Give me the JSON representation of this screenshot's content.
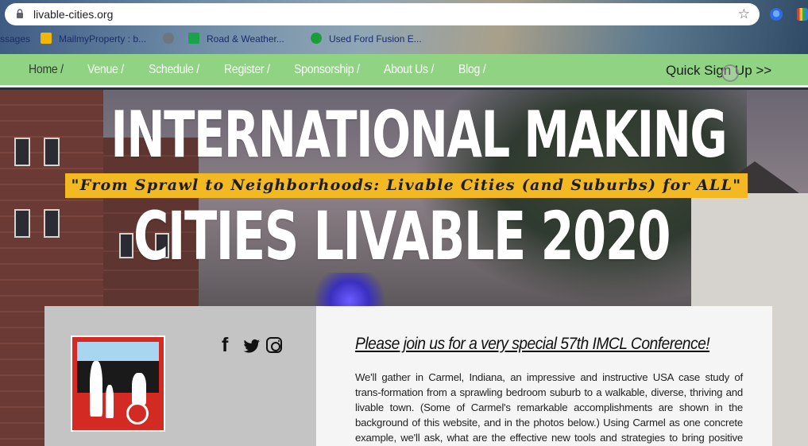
{
  "browser": {
    "url": "livable-cities.org",
    "bookmarks": [
      {
        "label": "ssages"
      },
      {
        "label": "MailmyProperty : b..."
      },
      {
        "label": "Road & Weather..."
      },
      {
        "label": "Used Ford Fusion E..."
      }
    ]
  },
  "nav": {
    "items": [
      "Home /",
      "Venue /",
      "Schedule /",
      "Register /",
      "Sponsorship /",
      "About Us /",
      "Blog /"
    ],
    "quick_signup": "Quick Sign Up >>"
  },
  "hero": {
    "title_line1": "INTERNATIONAL MAKING",
    "tagline": "\"From Sprawl to Neighborhoods: Livable Cities (and Suburbs) for ALL\"",
    "title_line2": "CITIES LIVABLE 2020"
  },
  "content": {
    "headline": "Please join us for a very special 57th IMCL Conference!",
    "body": "We'll gather in Carmel, Indiana, an impressive and instructive USA case study of trans-formation from a sprawling bedroom suburb to a walkable, diverse, thriving and livable town. (Some of Carmel's remarkable accomplishments are shown in the background of this website, and in the photos below.) Using Carmel as one concrete example, we'll ask, what are the effective new tools and strategies to bring positive change to suburban areas?",
    "social": [
      "facebook-icon",
      "twitter-icon",
      "instagram-icon"
    ]
  },
  "colors": {
    "nav_bg": "#8fd383",
    "tagline_bg": "#f2b923",
    "panel_left": "#c4c4c4",
    "panel_right": "#f5f5f5"
  }
}
